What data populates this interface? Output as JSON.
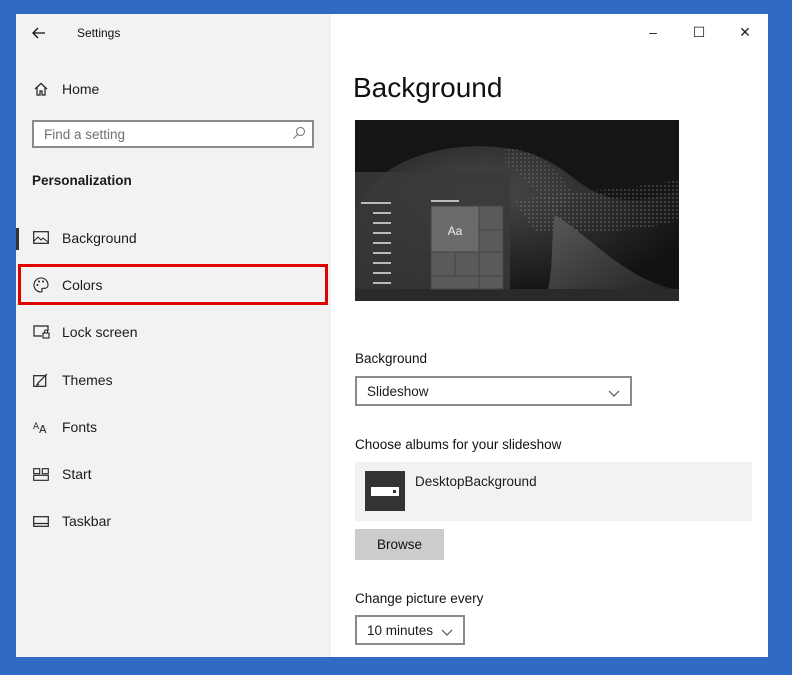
{
  "window": {
    "title": "Settings",
    "controls": {
      "minimize": "–",
      "maximize": "☐",
      "close": "✕"
    }
  },
  "sidebar": {
    "home_label": "Home",
    "search_placeholder": "Find a setting",
    "section_title": "Personalization",
    "items": [
      {
        "label": "Background",
        "icon": "picture-icon",
        "selected": true
      },
      {
        "label": "Colors",
        "icon": "palette-icon",
        "selected": false
      },
      {
        "label": "Lock screen",
        "icon": "lock-screen-icon",
        "selected": false
      },
      {
        "label": "Themes",
        "icon": "themes-icon",
        "selected": false
      },
      {
        "label": "Fonts",
        "icon": "fonts-icon",
        "selected": false
      },
      {
        "label": "Start",
        "icon": "start-icon",
        "selected": false
      },
      {
        "label": "Taskbar",
        "icon": "taskbar-icon",
        "selected": false
      }
    ]
  },
  "main": {
    "title": "Background",
    "preview_sample_text": "Aa",
    "background_label": "Background",
    "background_value": "Slideshow",
    "albums_label": "Choose albums for your slideshow",
    "album_name": "DesktopBackground",
    "browse_label": "Browse",
    "interval_label": "Change picture every",
    "interval_value": "10 minutes"
  },
  "colors": {
    "desktop": "#2f6bc4",
    "sidebar_bg": "#f2f2f2",
    "highlight": "#e00000",
    "button_bg": "#cccccc"
  }
}
